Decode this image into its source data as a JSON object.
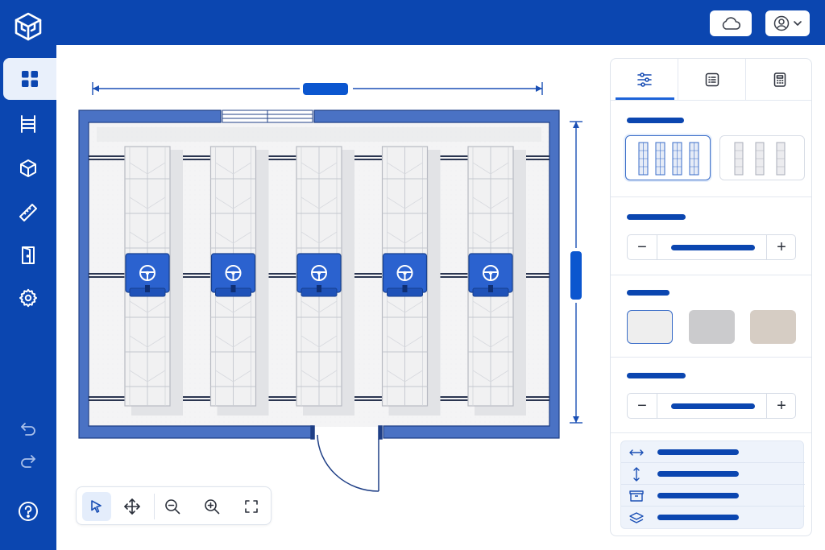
{
  "app": {
    "brand_color": "#0b46b0",
    "accent_color": "#1d63d9",
    "logo_icon": "isometric-cube-logo-icon"
  },
  "sidebar": {
    "items": [
      {
        "name": "dashboard",
        "icon": "grid-icon",
        "active": true
      },
      {
        "name": "rack",
        "icon": "shelving-rack-icon",
        "active": false
      },
      {
        "name": "object",
        "icon": "cube-icon",
        "active": false
      },
      {
        "name": "measure",
        "icon": "ruler-icon",
        "active": false
      },
      {
        "name": "door",
        "icon": "door-icon",
        "active": false
      },
      {
        "name": "settings",
        "icon": "gear-icon",
        "active": false
      }
    ],
    "bottom_items": [
      {
        "name": "undo",
        "icon": "undo-icon"
      },
      {
        "name": "redo",
        "icon": "redo-icon"
      },
      {
        "name": "help",
        "icon": "help-circle-icon"
      }
    ]
  },
  "topbar": {
    "cloud_icon": "cloud-icon",
    "user_icon": "user-avatar-icon",
    "menu_icon": "chevron-down-icon"
  },
  "floorplan": {
    "rack_rows": 5,
    "mobile_carriage_icon": "steering-wheel-icon",
    "wall_color": "#4a72c4",
    "carriage_color": "#2b62cf",
    "dimension_width_icon": "horizontal-dimension-icon",
    "dimension_height_icon": "vertical-dimension-icon"
  },
  "toolbar": {
    "tools": [
      {
        "name": "select",
        "icon": "pointer-icon",
        "active": true
      },
      {
        "name": "pan",
        "icon": "move-icon",
        "active": false
      },
      {
        "name": "zoom-out",
        "icon": "zoom-out-icon",
        "active": false
      },
      {
        "name": "zoom-in",
        "icon": "zoom-in-icon",
        "active": false
      },
      {
        "name": "fit",
        "icon": "fullscreen-icon",
        "active": false
      }
    ]
  },
  "panel": {
    "tabs": [
      {
        "icon": "sliders-icon",
        "active": true
      },
      {
        "icon": "list-icon",
        "active": false
      },
      {
        "icon": "calculator-icon",
        "active": false
      }
    ],
    "layout_options": [
      {
        "name": "dense",
        "selected": true
      },
      {
        "name": "spaced",
        "selected": false
      }
    ],
    "steppers": [
      {
        "minus": "−",
        "plus": "+"
      },
      {
        "minus": "−",
        "plus": "+"
      }
    ],
    "swatches": [
      {
        "color": "#eeeeee",
        "selected": true
      },
      {
        "color": "#cbcbcd",
        "selected": false
      },
      {
        "color": "#d6cdc4",
        "selected": false
      }
    ],
    "summary_icons": [
      "width-arrows-icon",
      "height-arrows-icon",
      "box-icon",
      "layers-icon"
    ]
  }
}
